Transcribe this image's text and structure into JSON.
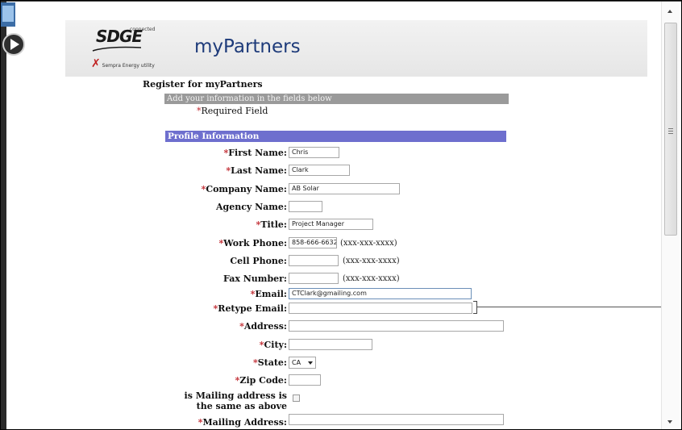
{
  "banner": {
    "logo_text": "SDGE",
    "logo_tag": "connected",
    "parent_company": "Sempra Energy utility",
    "app_title": "myPartners"
  },
  "form": {
    "heading": "Register for myPartners",
    "instructions": "Add your information in the fields below",
    "required_marker": "*",
    "required_note": "Required Field",
    "section_title": "Profile Information",
    "fields": [
      {
        "label": "First Name:",
        "required": true,
        "value": "Chris"
      },
      {
        "label": "Last Name:",
        "required": true,
        "value": "Clark"
      },
      {
        "label": "Company Name:",
        "required": true,
        "value": "AB Solar"
      },
      {
        "label": "Agency Name:",
        "required": false,
        "value": ""
      },
      {
        "label": "Title:",
        "required": true,
        "value": "Project Manager"
      },
      {
        "label": "Work Phone:",
        "required": true,
        "value": "858-666-6632",
        "hint": "(xxx-xxx-xxxx)"
      },
      {
        "label": "Cell Phone:",
        "required": false,
        "value": "",
        "hint": "(xxx-xxx-xxxx)"
      },
      {
        "label": "Fax Number:",
        "required": false,
        "value": "",
        "hint": "(xxx-xxx-xxxx)"
      },
      {
        "label": "Email:",
        "required": true,
        "value": "CTClark@gmailing.com"
      },
      {
        "label": "Retype Email:",
        "required": true,
        "value": ""
      },
      {
        "label": "Address:",
        "required": true,
        "value": ""
      },
      {
        "label": "City:",
        "required": true,
        "value": ""
      },
      {
        "label": "State:",
        "required": true,
        "value": "CA"
      },
      {
        "label": "Zip Code:",
        "required": true,
        "value": ""
      },
      {
        "label": "is Mailing address is the same as above",
        "required": false,
        "checked": false
      },
      {
        "label": "Mailing Address:",
        "required": true,
        "value": ""
      }
    ]
  },
  "colors": {
    "section_bar": "#6e6fce",
    "instructions_bar": "#9a9a9a",
    "required_star": "#c0282f",
    "title": "#1e3b7a"
  }
}
